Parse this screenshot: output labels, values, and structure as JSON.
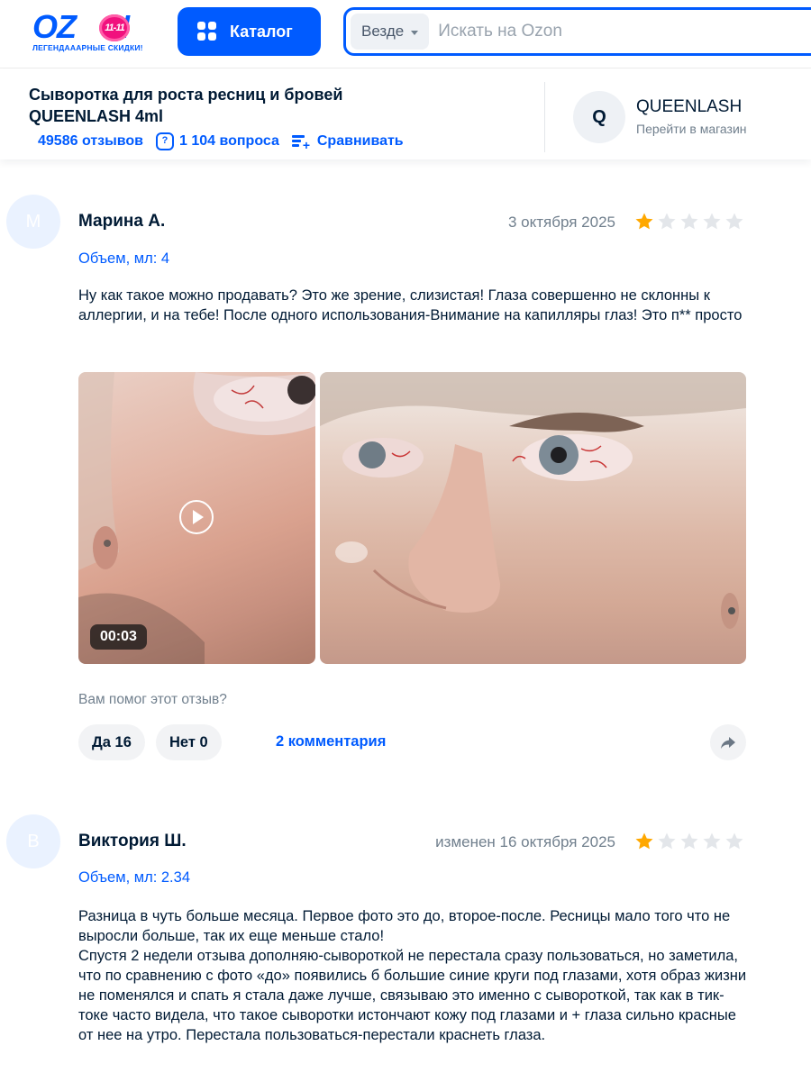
{
  "header": {
    "logo_text": "OZON",
    "logo_badge": "11-11",
    "logo_subtitle": "ЛЕГЕНДАААРНЫЕ СКИДКИ!",
    "catalog_label": "Каталог",
    "search_scope": "Везде",
    "search_placeholder": "Искать на Ozon"
  },
  "product": {
    "title": "Сыворотка для роста ресниц и бровей QUEENLASH 4ml",
    "reviews_link": "49586 отзывов",
    "questions_link": "1 104 вопроса",
    "compare_link": "Сравнивать",
    "shop_avatar_letter": "Q",
    "shop_name": "QUEENLASH",
    "shop_link": "Перейти в магазин"
  },
  "reviews": [
    {
      "avatar_letter": "М",
      "author": "Марина А.",
      "date": "3 октября 2025",
      "rating": 1,
      "variant": "Объем, мл: 4",
      "text": "Ну как такое можно продавать? Это же зрение, слизистая! Глаза совершенно не склонны к аллергии, и на тебе! После одного использования-Внимание на капилляры глаз! Это п** просто",
      "video_duration": "00:03",
      "helpful_question": "Вам помог этот отзыв?",
      "yes_label": "Да 16",
      "no_label": "Нет 0",
      "comments_label": "2 комментария"
    },
    {
      "avatar_letter": "В",
      "author": "Виктория Ш.",
      "date": "изменен 16 октября 2025",
      "rating": 1,
      "variant": "Объем, мл: 2.34",
      "text": "Разница в чуть больше месяца. Первое фото это до, второе-после. Ресницы мало того что не выросли больше, так их еще меньше стало!\nСпустя 2 недели отзыва дополняю-сывороткой не перестала сразу пользоваться, но заметила, что по сравнению с фото «до» появились б большие синие круги под глазами, хотя образ жизни не поменялся и спать я стала даже лучше, связываю это именно с сывороткой, так как в тик-токе часто видела, что такое сыворотки истончают кожу под глазами и + глаза сильно красные от нее на утро. Перестала пользоваться-перестали краснеть глаза."
    }
  ],
  "colors": {
    "brand_blue": "#005bff",
    "star_filled": "#ffa800",
    "star_empty": "#e3e6ea"
  }
}
